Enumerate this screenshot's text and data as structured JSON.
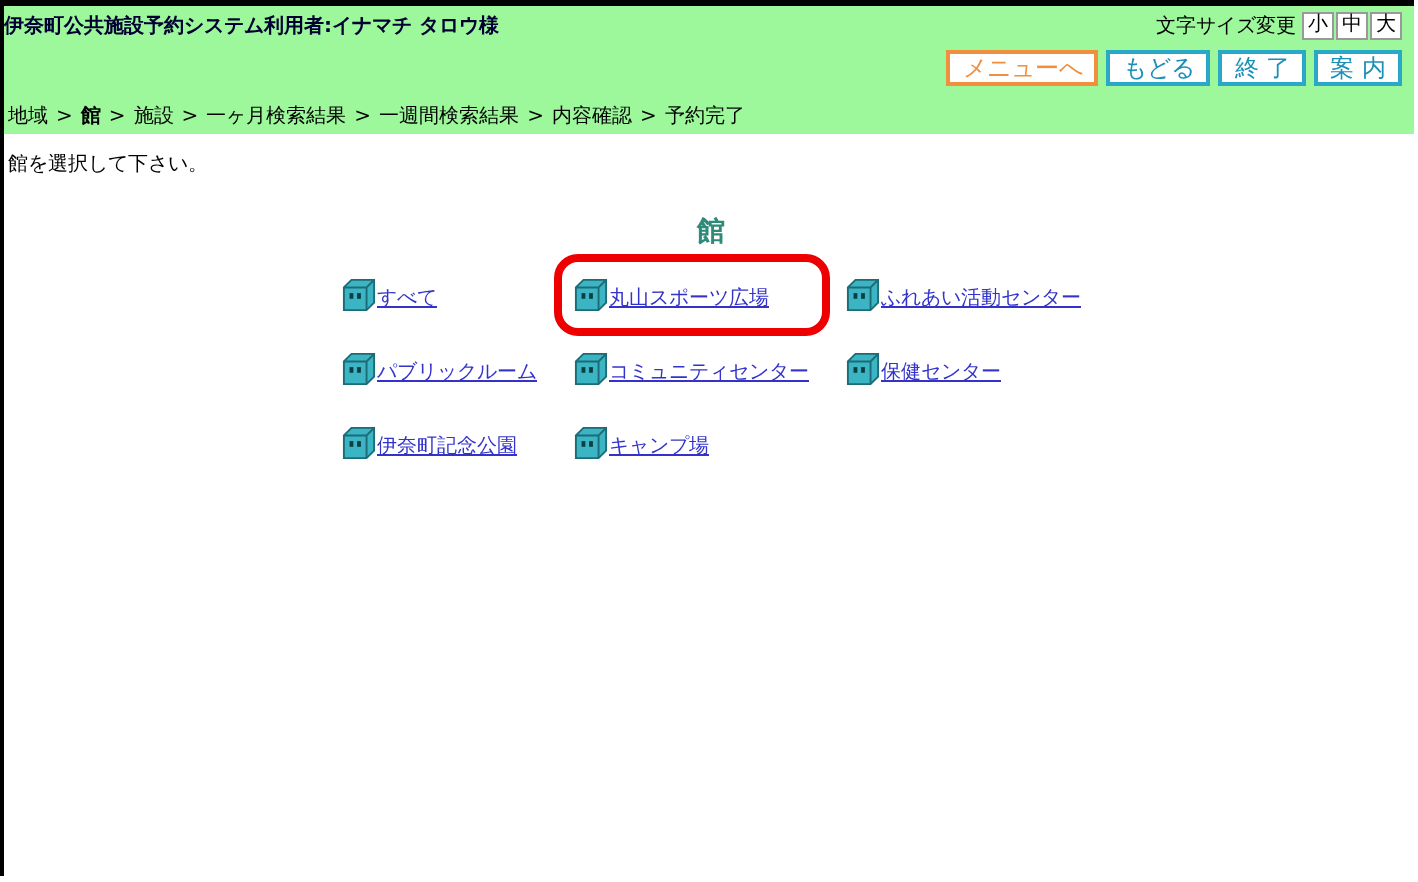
{
  "header": {
    "title": "伊奈町公共施設予約システム利用者:イナマチ タロウ様",
    "font_size_label": "文字サイズ変更",
    "font_sizes": [
      "小",
      "中",
      "大"
    ],
    "nav_buttons": [
      {
        "label": "メニューへ",
        "kind": "menu"
      },
      {
        "label": "もどる",
        "kind": "normal"
      },
      {
        "label": "終 了",
        "kind": "normal"
      },
      {
        "label": "案 内",
        "kind": "normal"
      }
    ]
  },
  "breadcrumb_separator": ">",
  "breadcrumb": [
    {
      "label": "地域",
      "current": false
    },
    {
      "label": "館",
      "current": true
    },
    {
      "label": "施設",
      "current": false
    },
    {
      "label": "一ヶ月検索結果",
      "current": false
    },
    {
      "label": "一週間検索結果",
      "current": false
    },
    {
      "label": "内容確認",
      "current": false
    },
    {
      "label": "予約完了",
      "current": false
    }
  ],
  "instruction": "館を選択して下さい。",
  "heading": "館",
  "facilities": [
    [
      {
        "label": "すべて",
        "highlighted": false
      },
      {
        "label": "丸山スポーツ広場",
        "highlighted": true
      },
      {
        "label": "ふれあい活動センター",
        "highlighted": false
      }
    ],
    [
      {
        "label": "パブリックルーム",
        "highlighted": false
      },
      {
        "label": "コミュニティセンター",
        "highlighted": false
      },
      {
        "label": "保健センター",
        "highlighted": false
      }
    ],
    [
      {
        "label": "伊奈町記念公園",
        "highlighted": false
      },
      {
        "label": "キャンプ場",
        "highlighted": false
      }
    ]
  ]
}
